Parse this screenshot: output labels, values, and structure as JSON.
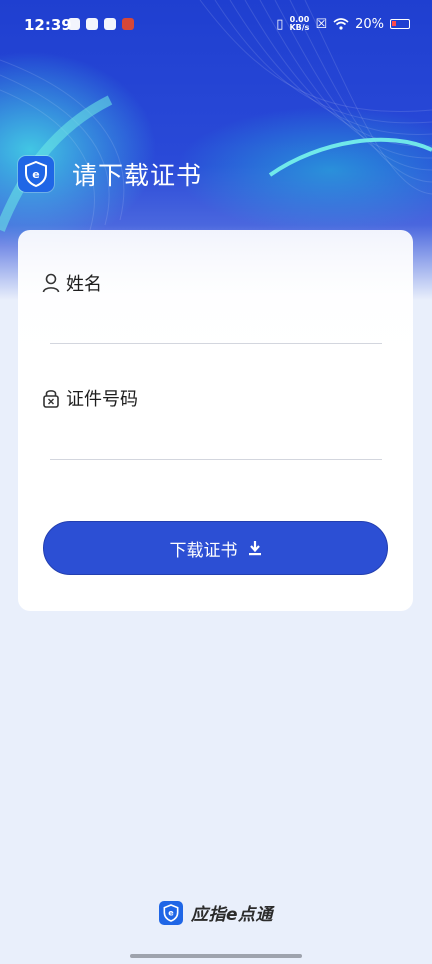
{
  "status_bar": {
    "time": "12:39",
    "net_speed_value": "0.00",
    "net_speed_unit": "KB/s",
    "battery_percent": "20%",
    "icons": [
      "mail-icon",
      "app-icon",
      "play-icon",
      "app-badge-icon",
      "vibrate-icon",
      "sim-icon",
      "wifi-icon",
      "battery-icon"
    ]
  },
  "header": {
    "title": "请下载证书",
    "logo_icon": "shield-e-icon"
  },
  "form": {
    "name_label": "姓名",
    "name_icon": "user-icon",
    "name_value": "",
    "id_label": "证件号码",
    "id_icon": "lock-icon",
    "id_value": ""
  },
  "actions": {
    "download_label": "下载证书",
    "download_icon": "download-icon"
  },
  "footer": {
    "brand": "应指e点通"
  },
  "colors": {
    "primary": "#2c4fd4",
    "brand_blue": "#1f66e6",
    "background": "#e9effb"
  }
}
